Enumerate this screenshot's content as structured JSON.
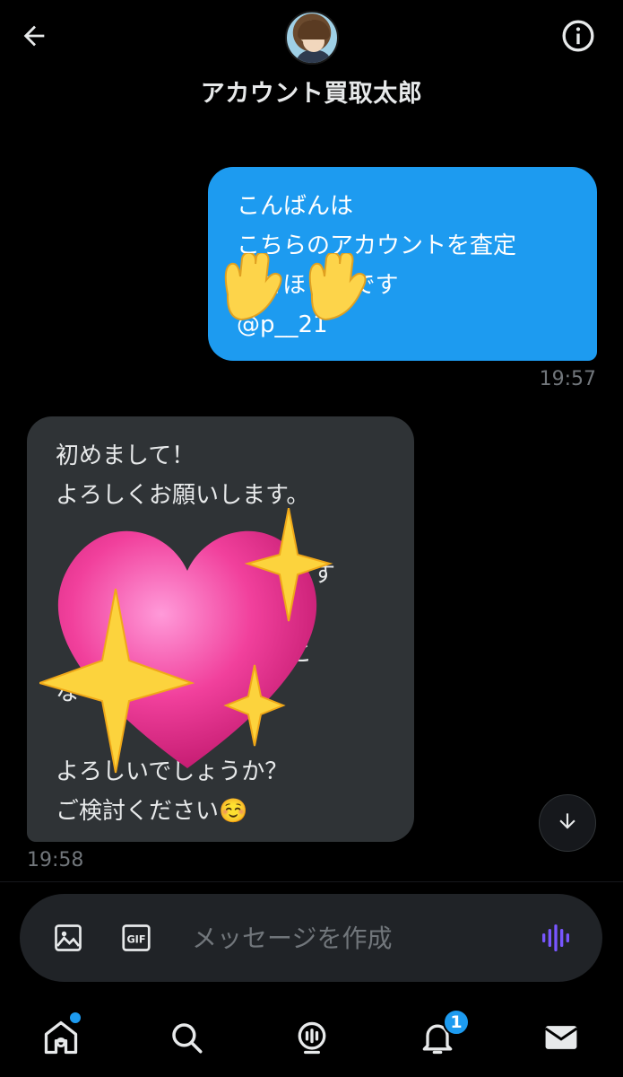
{
  "header": {
    "title": "アカウント買取太郎",
    "back_icon": "arrow-left-icon",
    "info_icon": "info-icon"
  },
  "messages": [
    {
      "direction": "outgoing",
      "text": "こんばんは\nこちらのアカウントを査定\nしてほしいです\n@p__21",
      "time": "19:57",
      "sticker": "raising-hands-emoji"
    },
    {
      "direction": "incoming",
      "text": "初めまして！\nよろしくお願いします。\n\n　　　　　　　　　　ます\n\n　　　　　　　　　】と\nな\n\nよろしいでしょうか？\nご検討ください☺️",
      "time": "19:58",
      "sticker": "sparkling-heart-emoji"
    }
  ],
  "composer": {
    "placeholder": "メッセージを作成"
  },
  "tabbar": {
    "notifications_badge": "1"
  },
  "colors": {
    "accent": "#1d9bf0",
    "incoming_bubble": "#2f3336",
    "voice": "#7856ff"
  }
}
